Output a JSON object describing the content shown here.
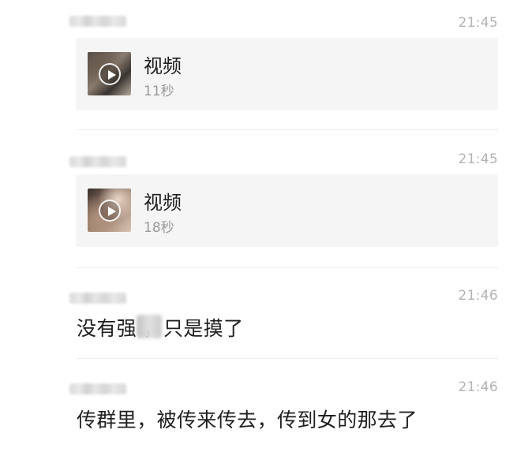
{
  "messages": [
    {
      "type": "video",
      "time": "21:45",
      "video": {
        "title": "视频",
        "duration": "11秒"
      }
    },
    {
      "type": "video",
      "time": "21:45",
      "video": {
        "title": "视频",
        "duration": "18秒"
      }
    },
    {
      "type": "text",
      "time": "21:46",
      "text": "没有强 ，只是摸了"
    },
    {
      "type": "text",
      "time": "21:46",
      "text": "传群里，被传来传去，传到女的那去了"
    }
  ],
  "icons": {
    "video": "play-icon"
  },
  "colors": {
    "time": "#b3b3b3",
    "card_bg": "#f5f5f5",
    "divider": "#ededed",
    "text": "#1f1f1f"
  }
}
